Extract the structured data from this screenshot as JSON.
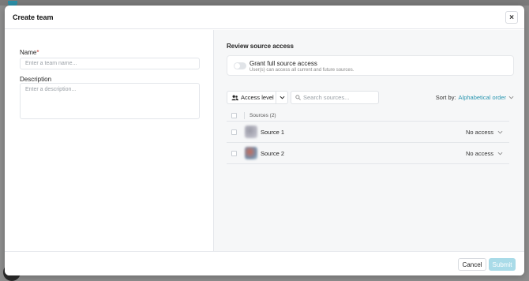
{
  "modal": {
    "title": "Create team",
    "close_glyph": "×"
  },
  "form": {
    "name_label": "Name",
    "name_required_mark": "*",
    "name_placeholder": "Enter a team name...",
    "description_label": "Description",
    "description_placeholder": "Enter a description..."
  },
  "access": {
    "section_title": "Review source access",
    "grant_title": "Grant full source access",
    "grant_description": "User(s) can access all current and future sources.",
    "grant_enabled": false,
    "access_level_label": "Access level",
    "search_placeholder": "Search sources...",
    "sort_label": "Sort by:",
    "sort_value": "Alphabetical order",
    "table_header": "Sources (2)",
    "sources": [
      {
        "name": "Source 1",
        "access": "No access"
      },
      {
        "name": "Source 2",
        "access": "No access"
      }
    ]
  },
  "footer": {
    "cancel_label": "Cancel",
    "submit_label": "Submit"
  },
  "colors": {
    "accent": "#2a96b0",
    "submit_disabled": "#a9dbe8",
    "required": "#c0392b"
  },
  "icons": [
    "close-icon",
    "users-icon",
    "chevron-down-icon",
    "search-icon"
  ]
}
